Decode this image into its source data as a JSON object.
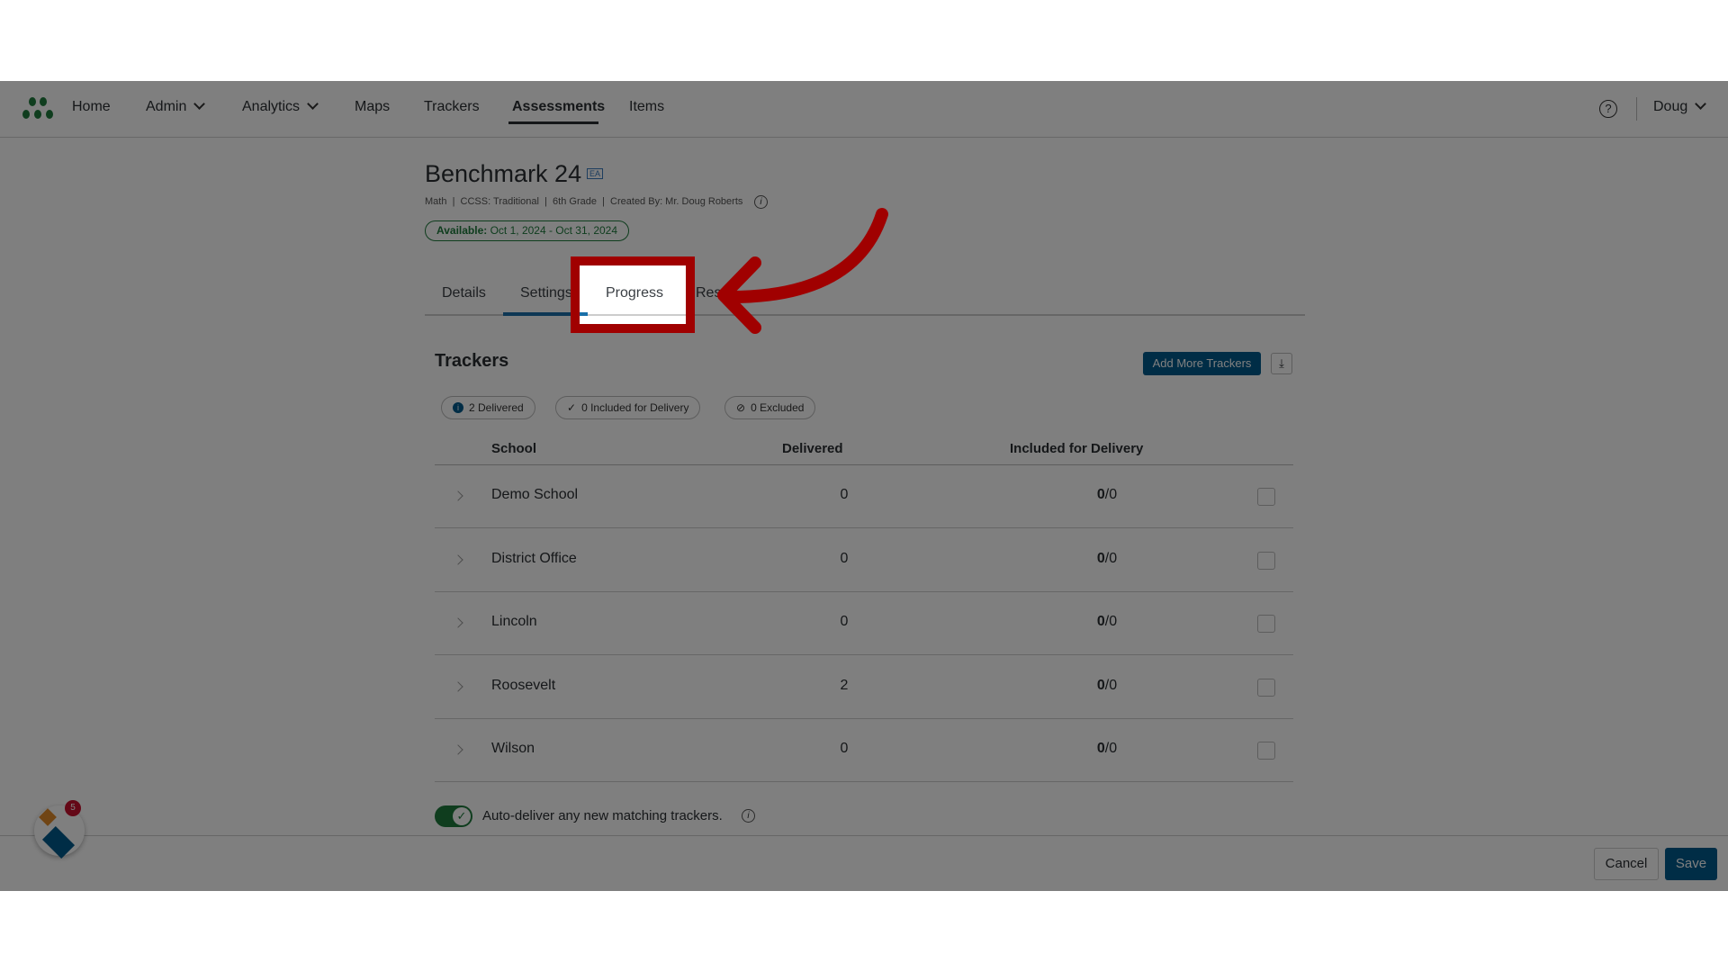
{
  "nav": {
    "items": [
      {
        "label": "Home"
      },
      {
        "label": "Admin",
        "dropdown": true
      },
      {
        "label": "Analytics",
        "dropdown": true
      },
      {
        "label": "Maps"
      },
      {
        "label": "Trackers"
      },
      {
        "label": "Assessments",
        "active": true
      },
      {
        "label": "Items"
      }
    ],
    "user": "Doug",
    "brand_color": "#1e7a3c"
  },
  "assessment": {
    "title": "Benchmark 24",
    "badge": "EA",
    "meta": "Math  |  CCSS: Traditional  |  6th Grade  |  Created By: Mr. Doug Roberts",
    "available_label": "Available:",
    "available_range": "Oct 1, 2024 - Oct 31, 2024"
  },
  "tabs": [
    {
      "label": "Details"
    },
    {
      "label": "Settings",
      "active": true
    },
    {
      "label": "Progress",
      "highlighted": true
    },
    {
      "label": "Res"
    }
  ],
  "trackers": {
    "heading": "Trackers",
    "add_button": "Add More Trackers",
    "chips": [
      {
        "label": "2 Delivered",
        "icon": "info-icon"
      },
      {
        "label": "0 Included for Delivery",
        "icon": "check-icon"
      },
      {
        "label": "0 Excluded",
        "icon": "ban-icon"
      }
    ],
    "columns": [
      "School",
      "Delivered",
      "Included for Delivery"
    ],
    "rows": [
      {
        "school": "Demo School",
        "delivered": "0",
        "included": "0",
        "total": "/0"
      },
      {
        "school": "District Office",
        "delivered": "0",
        "included": "0",
        "total": "/0"
      },
      {
        "school": "Lincoln",
        "delivered": "0",
        "included": "0",
        "total": "/0"
      },
      {
        "school": "Roosevelt",
        "delivered": "2",
        "included": "0",
        "total": "/0"
      },
      {
        "school": "Wilson",
        "delivered": "0",
        "included": "0",
        "total": "/0"
      }
    ],
    "auto_deliver_label": "Auto-deliver any new matching trackers.",
    "auto_deliver_on": true
  },
  "footer": {
    "cancel": "Cancel",
    "save": "Save"
  },
  "widget": {
    "badge_count": "5"
  },
  "colors": {
    "primary": "#005a8c",
    "annotation": "#a00000",
    "success": "#1e7a3c"
  }
}
